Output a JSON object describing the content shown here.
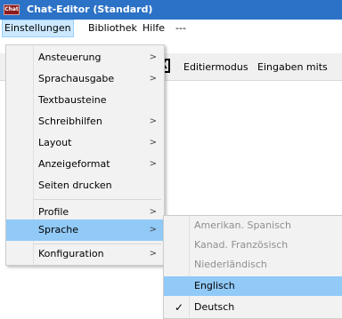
{
  "window": {
    "title": "Chat-Editor (Standard)",
    "icon_text": "Chat"
  },
  "menubar": {
    "items": [
      {
        "label": "Einstellungen"
      },
      {
        "label": "Bibliothek"
      },
      {
        "label": "Hilfe"
      },
      {
        "label": "---"
      }
    ]
  },
  "toolbar": {
    "x_label": "X",
    "editmode_label": "Editiermodus",
    "input_label": "Eingaben mits"
  },
  "settings_menu": {
    "items": [
      {
        "label": "Ansteuerung",
        "submenu": true
      },
      {
        "label": "Sprachausgabe",
        "submenu": true
      },
      {
        "label": "Textbausteine",
        "submenu": false
      },
      {
        "label": "Schreibhilfen",
        "submenu": true
      },
      {
        "label": "Layout",
        "submenu": true
      },
      {
        "label": "Anzeigeformat",
        "submenu": true
      },
      {
        "label": "Seiten drucken",
        "submenu": false
      },
      {
        "label": "Profile",
        "submenu": true
      },
      {
        "label": "Sprache",
        "submenu": true,
        "highlighted": true
      },
      {
        "label": "Konfiguration",
        "submenu": true
      }
    ],
    "arrow": ">"
  },
  "language_menu": {
    "items": [
      {
        "label": "Amerikan. Spanisch",
        "enabled": false
      },
      {
        "label": "Kanad. Französisch",
        "enabled": false
      },
      {
        "label": "Niederländisch",
        "enabled": false
      },
      {
        "label": "Englisch",
        "enabled": true,
        "hovered": true
      },
      {
        "label": "Deutsch",
        "enabled": true,
        "checked": true
      }
    ],
    "check_glyph": "✓"
  },
  "colors": {
    "titlebar": "#2c72c7",
    "menu_highlight": "#91c9f7",
    "menubar_active": "#cce8ff"
  }
}
